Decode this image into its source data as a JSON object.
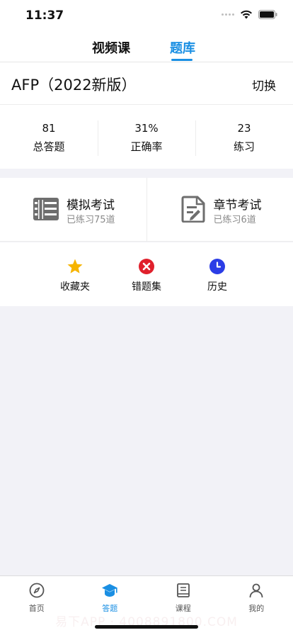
{
  "status_bar": {
    "time": "11:37"
  },
  "tabs": [
    {
      "label": "视频课",
      "active": false
    },
    {
      "label": "题库",
      "active": true
    }
  ],
  "exam": {
    "title": "AFP（2022新版）",
    "switch_label": "切换"
  },
  "stats": [
    {
      "value": "81",
      "label": "总答题"
    },
    {
      "value": "31%",
      "label": "正确率"
    },
    {
      "value": "23",
      "label": "练习"
    }
  ],
  "modes": [
    {
      "title": "模拟考试",
      "subtitle": "已练习75道",
      "icon": "exam-list-icon"
    },
    {
      "title": "章节考试",
      "subtitle": "已练习6道",
      "icon": "document-edit-icon"
    }
  ],
  "shortcuts": [
    {
      "label": "收藏夹",
      "icon": "star-icon",
      "color": "#f6b400"
    },
    {
      "label": "错题集",
      "icon": "close-circle-icon",
      "color": "#e0202c"
    },
    {
      "label": "历史",
      "icon": "clock-icon",
      "color": "#2b3de6"
    }
  ],
  "bottom_nav": [
    {
      "label": "首页",
      "icon": "compass-icon",
      "active": false
    },
    {
      "label": "答题",
      "icon": "graduation-cap-icon",
      "active": true
    },
    {
      "label": "课程",
      "icon": "book-icon",
      "active": false
    },
    {
      "label": "我的",
      "icon": "user-icon",
      "active": false
    }
  ],
  "watermark": "易下APP · 4008891800.COM",
  "colors": {
    "accent": "#1a8fe3",
    "page_bg": "#f2f2f7",
    "icon_gray": "#6e6e6e"
  }
}
